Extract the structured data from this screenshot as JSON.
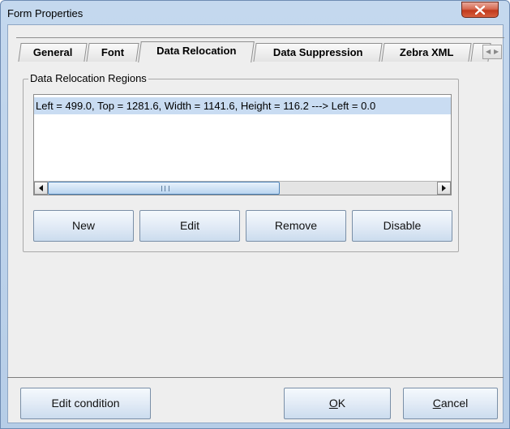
{
  "window": {
    "title": "Form Properties"
  },
  "tabs": [
    {
      "label": "General",
      "active": false
    },
    {
      "label": "Font",
      "active": false
    },
    {
      "label": "Data Relocation",
      "active": true
    },
    {
      "label": "Data Suppression",
      "active": false
    },
    {
      "label": "Zebra XML",
      "active": false
    }
  ],
  "group": {
    "title": "Data Relocation Regions",
    "rows": [
      "Left = 499.0, Top = 1281.6, Width = 1141.6, Height = 116.2 ---> Left = 0.0"
    ]
  },
  "region_buttons": {
    "new": "New",
    "edit": "Edit",
    "remove": "Remove",
    "disable": "Disable"
  },
  "footer": {
    "edit_condition": "Edit condition",
    "ok_mnemonic": "O",
    "ok_rest": "K",
    "cancel_mnemonic": "C",
    "cancel_rest": "ancel"
  },
  "colors": {
    "selection": "#c9dcf2",
    "close_button": "#c1391c",
    "frame": "#b6cde7"
  },
  "icons": [
    "close-icon",
    "scroll-left-icon",
    "scroll-right-icon",
    "tab-scroll-left-icon",
    "tab-scroll-right-icon"
  ]
}
